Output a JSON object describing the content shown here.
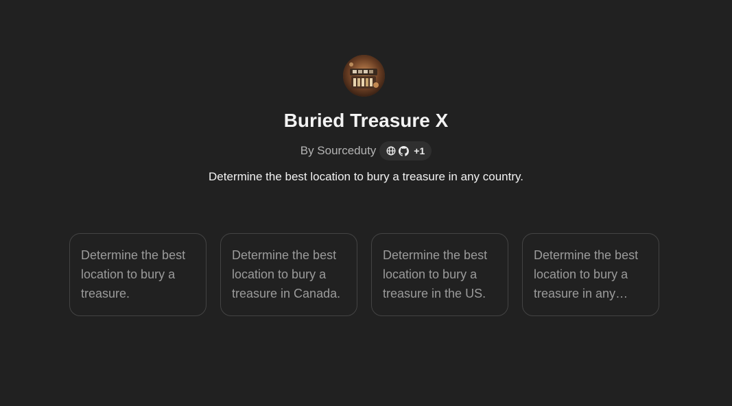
{
  "gpt": {
    "name": "Buried Treasure X",
    "byline": "By Sourceduty",
    "links": {
      "icons": [
        "globe-icon",
        "github-icon"
      ],
      "more_count": "+1"
    },
    "description": "Determine the best location to bury a treasure in any country."
  },
  "conversation_starters": [
    "Determine the best location to bury a treasure.",
    "Determine the best location to bury a treasure in Canada.",
    "Determine the best location to bury a treasure in the US.",
    "Determine the best location to bury a treasure in any country."
  ],
  "colors": {
    "background": "#212121",
    "card_border": "#444444",
    "pill_background": "#2f2f2f",
    "muted_text": "#b4b4b4",
    "starter_text": "#9b9b9b"
  }
}
